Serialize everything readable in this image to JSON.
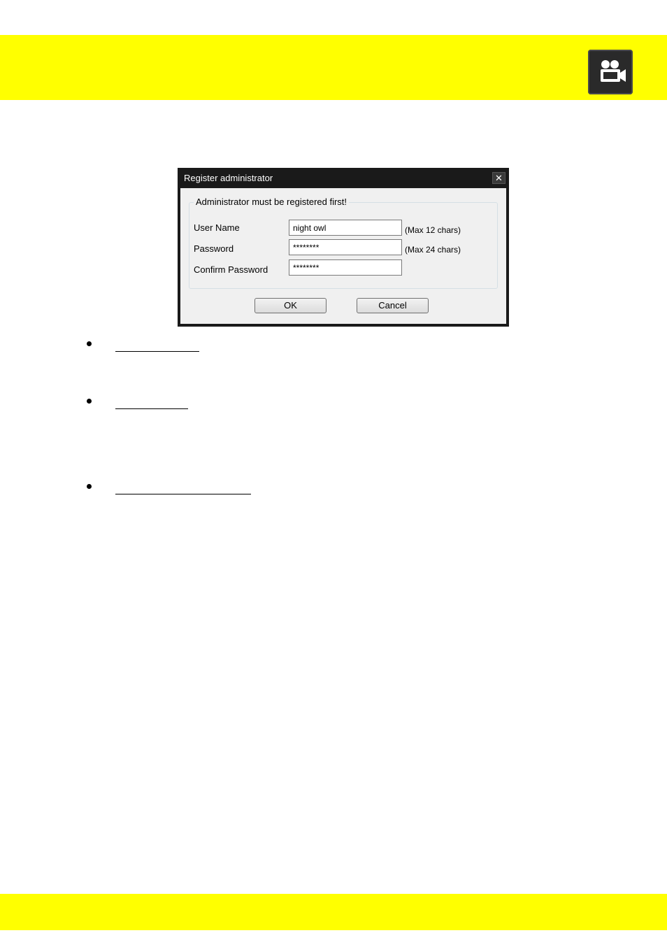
{
  "header": {
    "band_color": "#ffff00",
    "camera_icon": "video-camera-icon"
  },
  "dialog": {
    "title": "Register administrator",
    "close_icon": "close-icon",
    "group_title": "Administrator must be registered first!",
    "fields": [
      {
        "label": "User Name",
        "value": "night owl",
        "hint": "(Max 12 chars)"
      },
      {
        "label": "Password",
        "value": "********",
        "hint": "(Max 24 chars)"
      },
      {
        "label": "Confirm Password",
        "value": "********",
        "hint": ""
      }
    ],
    "ok_label": "OK",
    "cancel_label": "Cancel"
  },
  "footer": {
    "band_color": "#ffff00"
  }
}
